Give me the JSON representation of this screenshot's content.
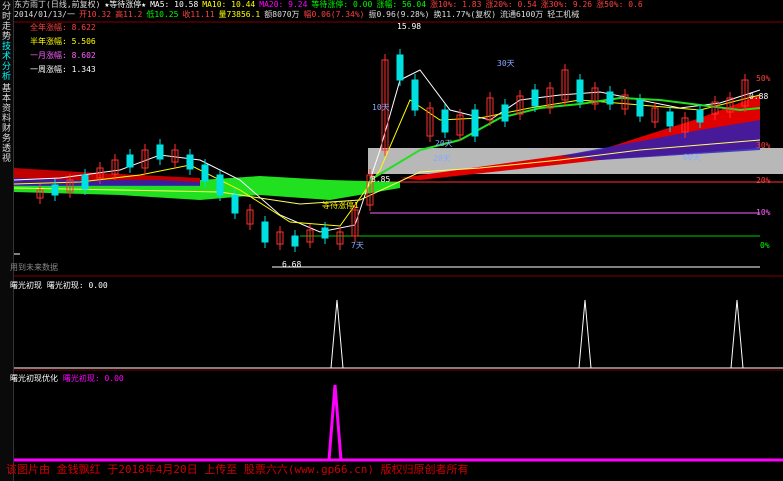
{
  "sidebar": [
    "分时走势",
    "技术分析",
    "基本资料",
    "财务透视"
  ],
  "header": {
    "line1": [
      {
        "t": "东方雨丁(日线,前复权)",
        "c": "#dddddd"
      },
      {
        "t": "★等待涨停★",
        "c": "#ffffff"
      },
      {
        "t": "MA5: 10.58",
        "c": "#ffffff"
      },
      {
        "t": "MA10: 10.44",
        "c": "#ffff00"
      },
      {
        "t": "MA20: 9.24",
        "c": "#ff00ff"
      },
      {
        "t": "等待涨停: 0.00",
        "c": "#00ff00"
      },
      {
        "t": "涨幅: 56.04",
        "c": "#00ff00"
      },
      {
        "t": "涨10%: 1.83",
        "c": "#ff4040"
      },
      {
        "t": "涨20%: 0.54",
        "c": "#ff4040"
      },
      {
        "t": "涨30%: 9.26",
        "c": "#ff4040"
      },
      {
        "t": "涨50%: 0.6",
        "c": "#ff4040"
      }
    ],
    "line2": [
      {
        "t": "2014/01/13/一",
        "c": "#dddddd"
      },
      {
        "t": "开10.32",
        "c": "#ff4040"
      },
      {
        "t": "高11.2",
        "c": "#ff4040"
      },
      {
        "t": "低10.25",
        "c": "#00ff00"
      },
      {
        "t": "收11.11",
        "c": "#ff4040"
      },
      {
        "t": "量73856.1",
        "c": "#ffff00"
      },
      {
        "t": "额8070万",
        "c": "#dddddd"
      },
      {
        "t": "幅0.06(7.34%)",
        "c": "#ff4040"
      },
      {
        "t": "振0.96(9.28%)",
        "c": "#dddddd"
      },
      {
        "t": "换11.77%(复权)",
        "c": "#dddddd"
      },
      {
        "t": "流通6100万",
        "c": "#dddddd"
      },
      {
        "t": "轻工机械",
        "c": "#dddddd"
      }
    ]
  },
  "legend": [
    {
      "t": "全年涨幅: 8.622",
      "c": "#ff4040"
    },
    {
      "t": "半年涨幅: 5.506",
      "c": "#ffff00"
    },
    {
      "t": "一月涨幅: 8.602",
      "c": "#ff60ff"
    },
    {
      "t": "一周涨幅: 1.343",
      "c": "#ffffff"
    }
  ],
  "annotations": {
    "peak": "15.98",
    "t30": "30天",
    "t10": "10天",
    "t20a": "20天",
    "t20b": "20天",
    "t60": "60天",
    "t7": "7天",
    "low_marker": "等待涨停1",
    "low_price": "6.68",
    "hi_right": "0.88",
    "left_mark": "8.85",
    "future": "用到未来数据"
  },
  "right_labels": {
    "p50": "50%",
    "p30": "30%",
    "p20": "20%",
    "p10": "10%",
    "p0": "0%"
  },
  "indicator1": {
    "title": "曙光初现",
    "label": "曙光初现: 0.00"
  },
  "indicator2": {
    "title": "曙光初现优化",
    "label": "曙光初现: 0.00"
  },
  "footer": "该图片由 金钱飘红 于2018年4月20日 上传至 股票六六(www.gp66.cn) 版权归原创者所有"
}
